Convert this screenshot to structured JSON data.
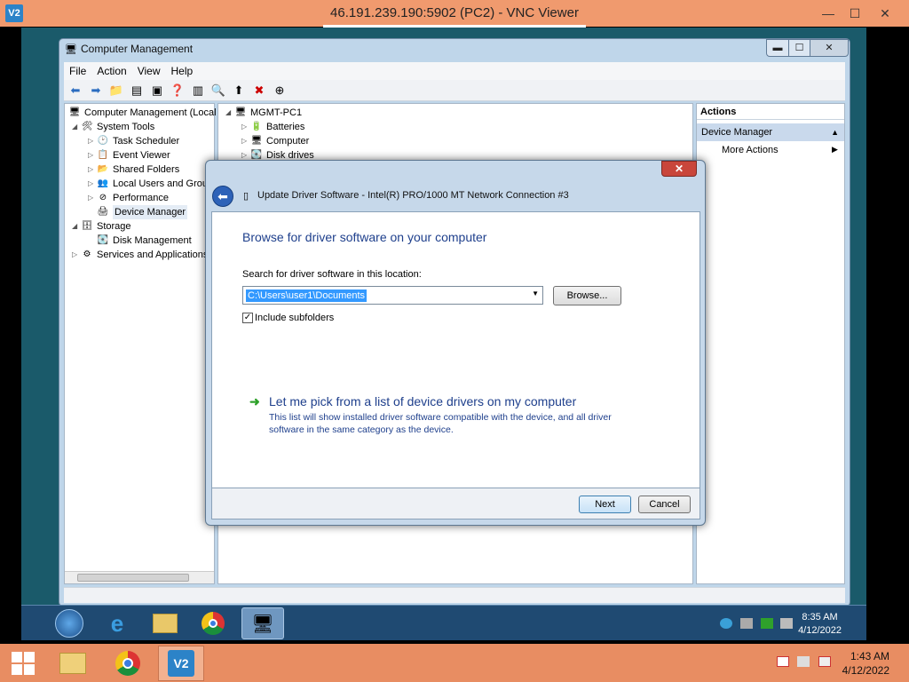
{
  "vnc": {
    "title": "46.191.239.190:5902 (PC2) - VNC Viewer",
    "logo": "V2",
    "minimize": "—",
    "restore": "☐",
    "close": "✕"
  },
  "cm": {
    "title": "Computer Management",
    "menu": [
      "File",
      "Action",
      "View",
      "Help"
    ],
    "tree": {
      "root": "Computer Management (Local",
      "system_tools": "System Tools",
      "task_scheduler": "Task Scheduler",
      "event_viewer": "Event Viewer",
      "shared_folders": "Shared Folders",
      "local_users": "Local Users and Group",
      "performance": "Performance",
      "device_manager": "Device Manager",
      "storage": "Storage",
      "disk_management": "Disk Management",
      "services": "Services and Applications"
    },
    "devices": {
      "root": "MGMT-PC1",
      "batteries": "Batteries",
      "computer": "Computer",
      "disk_drives": "Disk drives"
    },
    "actions": {
      "header": "Actions",
      "section": "Device Manager",
      "more": "More Actions"
    }
  },
  "dialog": {
    "title": "Update Driver Software - Intel(R) PRO/1000 MT Network Connection #3",
    "heading": "Browse for driver software on your computer",
    "search_label": "Search for driver software in this location:",
    "path": "C:\\Users\\user1\\Documents",
    "browse": "Browse...",
    "include_subfolders": "Include subfolders",
    "include_subfolders_checked": true,
    "pick_title": "Let me pick from a list of device drivers on my computer",
    "pick_desc": "This list will show installed driver software compatible with the device, and all driver software in the same category as the device.",
    "next": "Next",
    "cancel": "Cancel"
  },
  "guest_taskbar": {
    "time": "8:35 AM",
    "date": "4/12/2022"
  },
  "host_taskbar": {
    "time": "1:43 AM",
    "date": "4/12/2022"
  }
}
